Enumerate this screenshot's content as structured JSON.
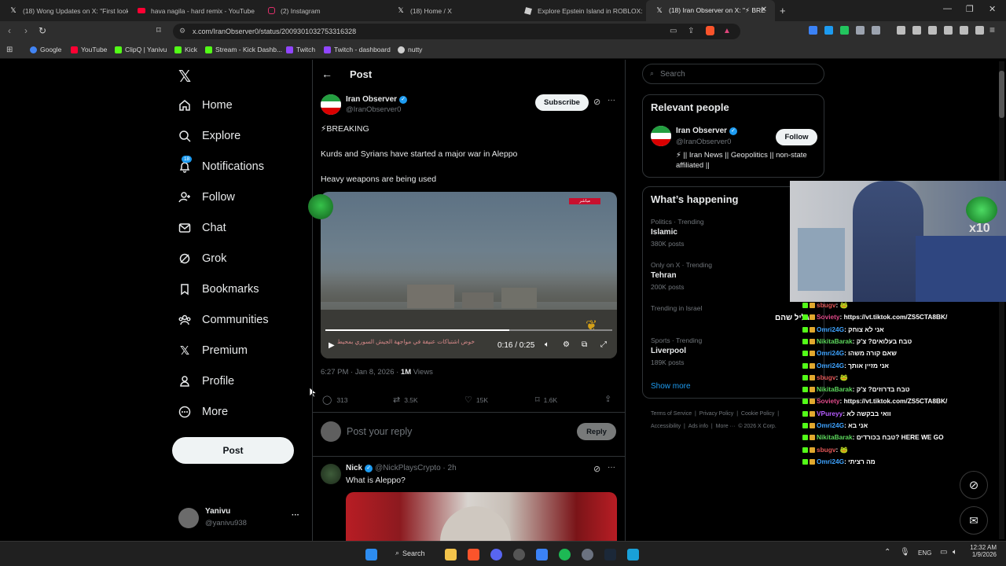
{
  "browser": {
    "tabs": [
      {
        "icon": "x-logo-icon",
        "title": "(18) Wong Updates on X: \"First look"
      },
      {
        "icon": "youtube-icon",
        "title": "hava nagila - hard remix - YouTube"
      },
      {
        "icon": "instagram-icon",
        "title": "(2) Instagram"
      },
      {
        "icon": "x-logo-icon",
        "title": "(18) Home / X"
      },
      {
        "icon": "roblox-icon",
        "title": "Explore Epstein Island in ROBLOX: Ca"
      },
      {
        "icon": "x-logo-icon",
        "title": "(18) Iran Observer on X: \"⚡ BRE"
      }
    ],
    "new_tab": "+",
    "url": "x.com/IranObserver0/status/2009301032753316328",
    "bookmarks": [
      "Google",
      "YouTube",
      "ClipQ | Yanivu",
      "Kick",
      "Stream - Kick Dashb...",
      "Twitch",
      "Twitch - dashboard",
      "nutty"
    ]
  },
  "sidebar": {
    "nav": [
      {
        "icon": "home-icon",
        "label": "Home"
      },
      {
        "icon": "explore-icon",
        "label": "Explore"
      },
      {
        "icon": "bell-icon",
        "label": "Notifications",
        "badge": "18"
      },
      {
        "icon": "follow-icon",
        "label": "Follow"
      },
      {
        "icon": "mail-icon",
        "label": "Chat"
      },
      {
        "icon": "grok-icon",
        "label": "Grok"
      },
      {
        "icon": "bookmark-icon",
        "label": "Bookmarks"
      },
      {
        "icon": "communities-icon",
        "label": "Communities"
      },
      {
        "icon": "x-logo-icon",
        "label": "Premium"
      },
      {
        "icon": "profile-icon",
        "label": "Profile"
      },
      {
        "icon": "more-circle-icon",
        "label": "More"
      }
    ],
    "post_button": "Post",
    "account": {
      "name": "Yanivu",
      "handle": "@yanivu938",
      "more": "···"
    }
  },
  "post": {
    "header_title": "Post",
    "author_name": "Iran Observer",
    "author_handle": "@IranObserver0",
    "subscribe": "Subscribe",
    "line1": "⚡BREAKING",
    "line2": "Kurds and Syrians have started a major war in Aleppo",
    "line3": "Heavy weapons are being used",
    "video_time": "0:16 / 0:25",
    "video_progress": 0.64,
    "video_caption": "خوض اشتباكات عنيفة في مواجهة الجيش السوري بمحيط",
    "video_tag": "مباشر",
    "timestamp": "6:27 PM · Jan 8, 2026 · ",
    "views_count": "1M",
    "views_label": "Views",
    "stats": {
      "replies": "313",
      "reposts": "3.5K",
      "likes": "15K",
      "bookmarks": "1.6K"
    },
    "reply_placeholder": "Post your reply",
    "reply_button": "Reply"
  },
  "reply": {
    "name": "Nick",
    "handle": "@NickPlaysCrypto",
    "time": "· 2h",
    "text": "What is Aleppo?"
  },
  "right": {
    "search_placeholder": "Search",
    "relevant_title": "Relevant people",
    "person": {
      "name": "Iran Observer",
      "handle": "@IranObserver0",
      "bio": "⚡ || Iran News || Geopolitics || non-state affiliated ||",
      "follow": "Follow"
    },
    "happening_title": "What’s happening",
    "trends": [
      {
        "context": "Politics · Trending",
        "name": "Islamic",
        "posts": "380K posts"
      },
      {
        "context": "Only on X · Trending",
        "name": "Tehran",
        "posts": "200K posts"
      },
      {
        "context": "Trending in Israel",
        "name": "",
        "posts": ""
      },
      {
        "context": "Sports · Trending",
        "name": "Liverpool",
        "posts": "189K posts"
      }
    ],
    "show_more": "Show more",
    "footer1": [
      "Terms of Service",
      "|",
      "Privacy Policy",
      "|",
      "Cookie Policy",
      "|"
    ],
    "footer2": [
      "Accessibility",
      "|",
      "Ads info",
      "|",
      "More ···",
      "© 2026 X Corp."
    ]
  },
  "overlay": {
    "emote_label": "x10",
    "hebrew_trend": "גליל שהם",
    "chat": [
      {
        "user": "sbugv",
        "color": "#e05555",
        "msg": ": 🐸"
      },
      {
        "user": "Soviety",
        "color": "#e04a8a",
        "msg": ": https://vt.tiktok.com/ZS5CTA8BK/"
      },
      {
        "user": "Omri24G",
        "color": "#3ea3ff",
        "msg": ": אני לא צוחק"
      },
      {
        "user": "NikitaBarak",
        "color": "#5cd65c",
        "msg": ": טבח בעלואים? צ'ק"
      },
      {
        "user": "Omri24G",
        "color": "#3ea3ff",
        "msg": ": שאם קורה משהו"
      },
      {
        "user": "Omri24G",
        "color": "#3ea3ff",
        "msg": ": אני מזיין אותך"
      },
      {
        "user": "sbugv",
        "color": "#e05555",
        "msg": ": 🐸"
      },
      {
        "user": "NikitaBarak",
        "color": "#5cd65c",
        "msg": ": טבח בדרוזים? צ'ק"
      },
      {
        "user": "Soviety",
        "color": "#e04a8a",
        "msg": ": https://vt.tiktok.com/ZS5CTA8BK/"
      },
      {
        "user": "VPureyy",
        "color": "#b65cff",
        "msg": ": וואי בבקשה לא"
      },
      {
        "user": "Omri24G",
        "color": "#3ea3ff",
        "msg": ": אני בא"
      },
      {
        "user": "NikitaBarak",
        "color": "#5cd65c",
        "msg": ": טבח בכורדים? HERE WE GO"
      },
      {
        "user": "sbugv",
        "color": "#e05555",
        "msg": ": 🐸"
      },
      {
        "user": "Omri24G",
        "color": "#3ea3ff",
        "msg": ": מה רציתי"
      }
    ]
  },
  "taskbar": {
    "search": "Search",
    "lang": "ENG",
    "time": "12:32 AM",
    "date": "1/9/2026"
  },
  "colors": {
    "accent": "#1d9bf0",
    "bg": "#000000",
    "border": "#2f3336",
    "muted": "#71767b"
  }
}
